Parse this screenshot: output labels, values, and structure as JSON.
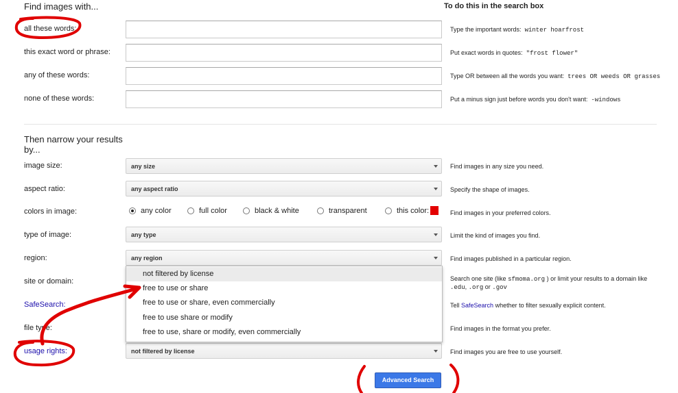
{
  "find_section": {
    "heading": "Find images with...",
    "right_heading": "To do this in the search box",
    "rows": [
      {
        "label": "all these words:",
        "value": "",
        "help": "Type the important words:",
        "help_code": "winter hoarfrost"
      },
      {
        "label": "this exact word or phrase:",
        "value": "",
        "help": "Put exact words in quotes:",
        "help_code": "\"frost flower\""
      },
      {
        "label": "any of these words:",
        "value": "",
        "help": "Type OR between all the words you want:",
        "help_code": "trees OR weeds OR grasses"
      },
      {
        "label": "none of these words:",
        "value": "",
        "help": "Put a minus sign just before words you don't want:",
        "help_code": "-windows"
      }
    ]
  },
  "narrow_section": {
    "heading_line1": "Then narrow your results",
    "heading_line2": "by...",
    "image_size": {
      "label": "image size:",
      "value": "any size",
      "help": "Find images in any size you need."
    },
    "aspect_ratio": {
      "label": "aspect ratio:",
      "value": "any aspect ratio",
      "help": "Specify the shape of images."
    },
    "colors": {
      "label": "colors in image:",
      "options": [
        "any color",
        "full color",
        "black & white",
        "transparent",
        "this color:"
      ],
      "selected": "any color",
      "swatch_color": "#e30000",
      "help": "Find images in your preferred colors."
    },
    "type_of_image": {
      "label": "type of image:",
      "value": "any type",
      "help": "Limit the kind of images you find."
    },
    "region": {
      "label": "region:",
      "value": "any region",
      "help": "Find images published in a particular region."
    },
    "site": {
      "label": "site or domain:",
      "help_a": "Search one site (like",
      "help_code1": "sfmoma.org",
      "help_b": ") or limit your results to a domain like",
      "help_code2": ".edu",
      "help_c": ",",
      "help_code3": ".org",
      "help_d": "or",
      "help_code4": ".gov"
    },
    "safesearch": {
      "label": "SafeSearch:",
      "help_a": "Tell",
      "help_kw": "SafeSearch",
      "help_b": "whether to filter sexually explicit content."
    },
    "file_type": {
      "label": "file type:",
      "help": "Find images in the format you prefer."
    },
    "usage_rights": {
      "label": "usage rights:",
      "value": "not filtered by license",
      "help": "Find images you are free to use yourself."
    }
  },
  "usage_dropdown": {
    "options": [
      "not filtered by license",
      "free to use or share",
      "free to use or share, even commercially",
      "free to use share or modify",
      "free to use, share or modify, even commercially"
    ],
    "highlighted": "not filtered by license"
  },
  "advanced_search_button": "Advanced Search",
  "annotation_color": "#e00000"
}
